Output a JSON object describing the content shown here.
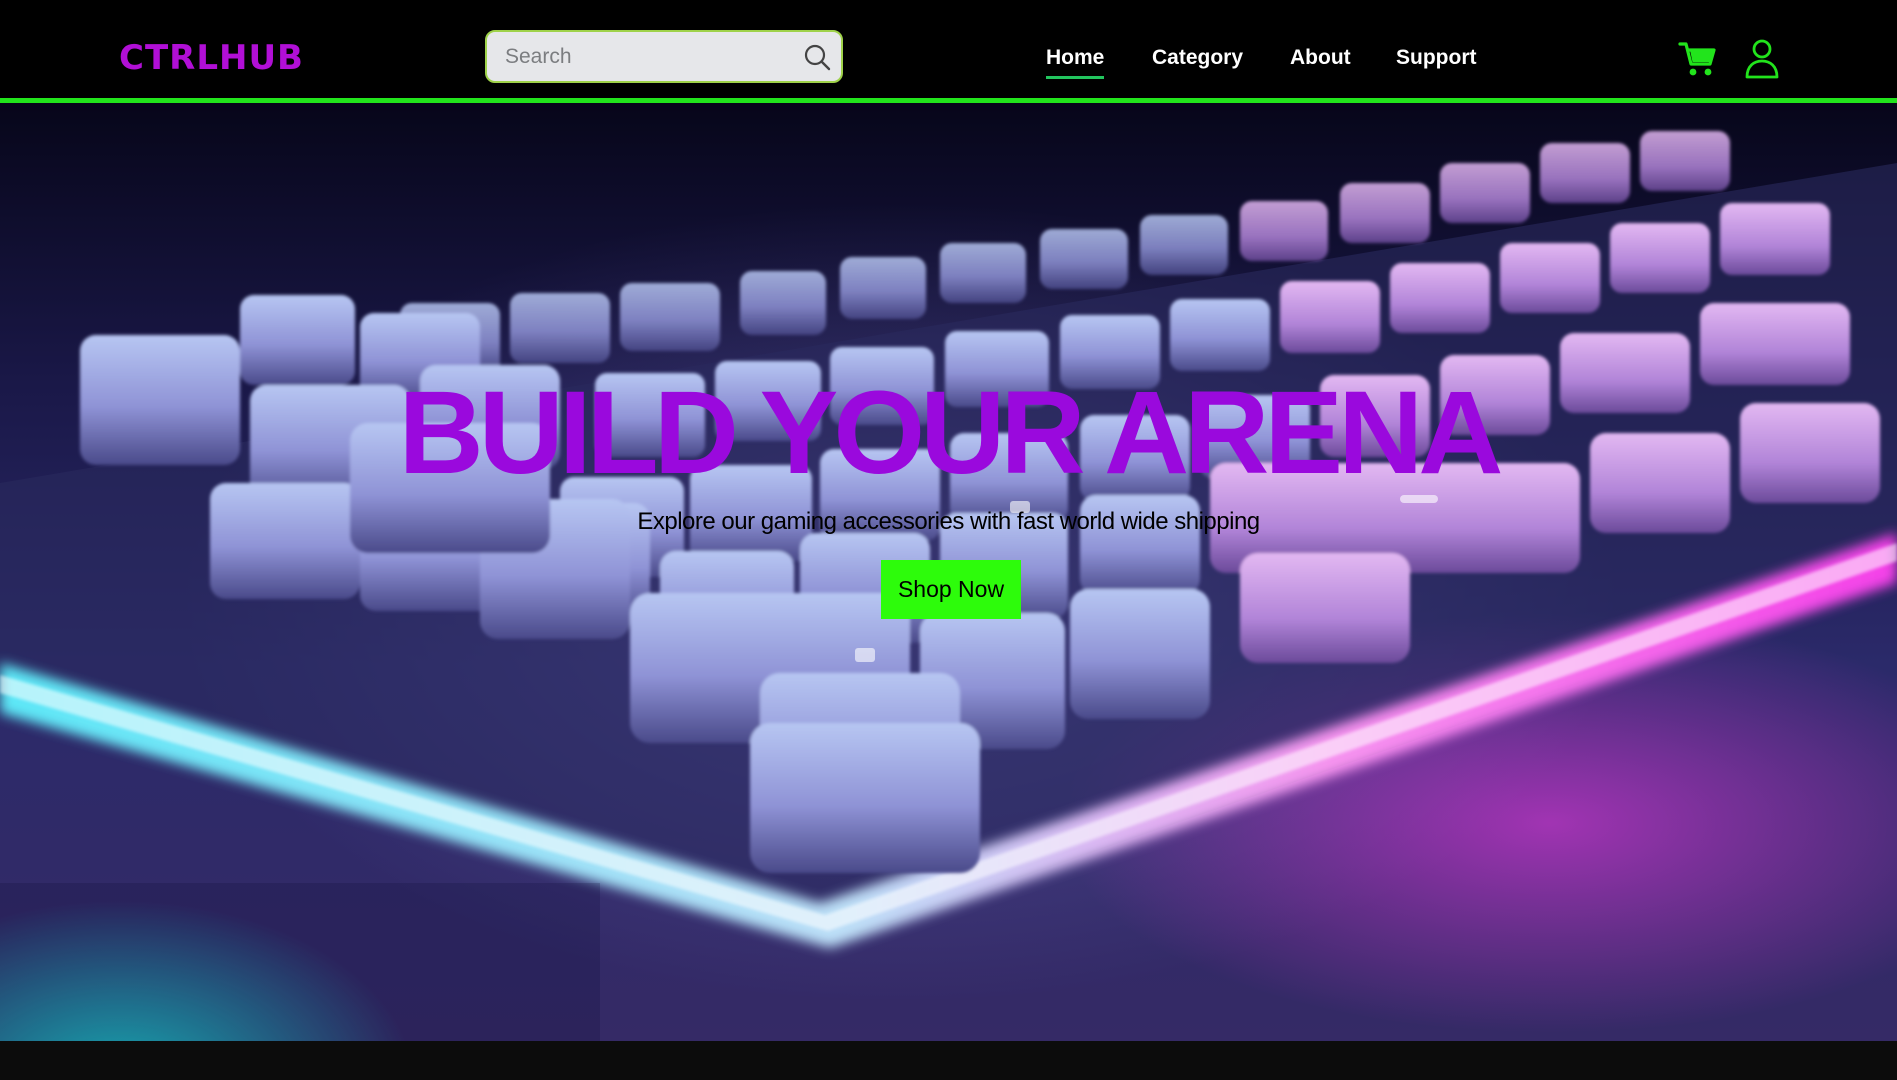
{
  "header": {
    "logo": "CTRLHUB",
    "search": {
      "placeholder": "Search",
      "value": ""
    },
    "nav": [
      {
        "label": "Home",
        "active": true
      },
      {
        "label": "Category",
        "active": false
      },
      {
        "label": "About",
        "active": false
      },
      {
        "label": "Support",
        "active": false
      }
    ],
    "icons": {
      "cart": "cart-icon",
      "user": "user-icon",
      "search": "search-icon"
    }
  },
  "hero": {
    "title": "BUILD YOUR ARENA",
    "subtitle": "Explore our gaming accessories with fast world wide shipping",
    "cta_label": "Shop Now"
  },
  "colors": {
    "brand": "#b10fd6",
    "accent_green": "#22e41c",
    "cta_green": "#2dfc0b",
    "title_purple": "#9a09dd",
    "header_bg": "#000000"
  }
}
